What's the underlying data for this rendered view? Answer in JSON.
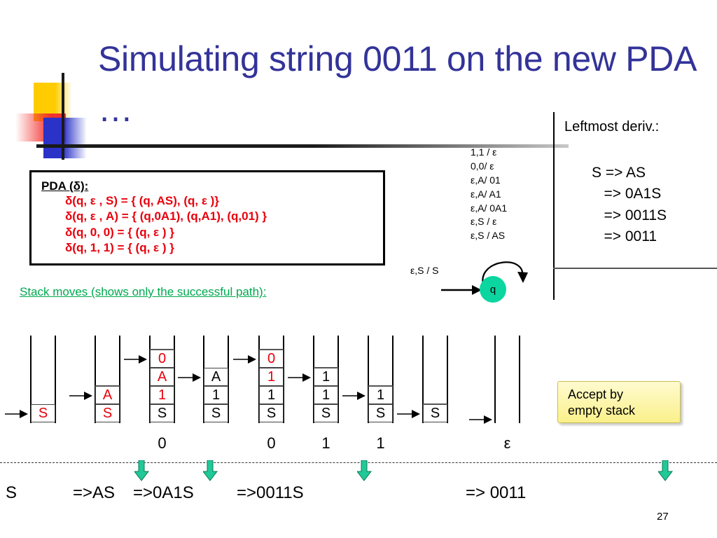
{
  "slide": {
    "title": "Simulating string 0011 on the new PDA …",
    "number": "27"
  },
  "pda_box": {
    "heading": "PDA (δ):",
    "rules": [
      "δ(q, ε , S) = { (q, AS), (q, ε )}",
      "δ(q, ε , A) = { (q,0A1), (q,A1), (q,01) }",
      "δ(q, 0, 0) = { (q, ε ) }",
      "δ(q, 1, 1) = { (q, ε ) }"
    ],
    "rule_color": "#E8000B"
  },
  "stack_moves": {
    "heading": "Stack moves (shows only the successful path):"
  },
  "automaton": {
    "state_label": "q",
    "state_color": "#0BD6A0",
    "start_label": "ε,S / S",
    "loop_labels": [
      "1,1 / ε",
      "0,0/ ε",
      "ε,A/ 01",
      "ε,A/ A1",
      "ε,A/ 0A1",
      "ε,S / ε",
      "ε,S / AS"
    ]
  },
  "leftmost": {
    "title": "Leftmost deriv.:",
    "lines": [
      "S => AS",
      "   => 0A1S",
      "   => 0011S",
      "   => 0011"
    ]
  },
  "accept_note": {
    "line1": "Accept by",
    "line2": "empty stack",
    "color": "#FAF08A"
  },
  "stacks": [
    {
      "cells": [
        {
          "t": "S",
          "red": true
        }
      ],
      "arrow_level": 0,
      "topline": false,
      "input": ""
    },
    {
      "cells": [
        {
          "t": "S",
          "red": true
        },
        {
          "t": "A",
          "red": true
        }
      ],
      "arrow_level": 1,
      "topline": true,
      "input": ""
    },
    {
      "cells": [
        {
          "t": "S",
          "red": false
        },
        {
          "t": "1",
          "red": true
        },
        {
          "t": "A",
          "red": true
        },
        {
          "t": "0",
          "red": true
        }
      ],
      "arrow_level": 3,
      "topline": true,
      "input": "0"
    },
    {
      "cells": [
        {
          "t": "S",
          "red": false
        },
        {
          "t": "1",
          "red": false
        },
        {
          "t": "A",
          "red": false
        }
      ],
      "arrow_level": 2,
      "topline": false,
      "input": ""
    },
    {
      "cells": [
        {
          "t": "S",
          "red": false
        },
        {
          "t": "1",
          "red": false
        },
        {
          "t": "1",
          "red": true
        },
        {
          "t": "0",
          "red": true
        }
      ],
      "arrow_level": 3,
      "topline": true,
      "input": "0"
    },
    {
      "cells": [
        {
          "t": "S",
          "red": false
        },
        {
          "t": "1",
          "red": false
        },
        {
          "t": "1",
          "red": false
        }
      ],
      "arrow_level": 2,
      "topline": true,
      "input": "1"
    },
    {
      "cells": [
        {
          "t": "S",
          "red": false
        },
        {
          "t": "1",
          "red": false
        }
      ],
      "arrow_level": 1,
      "topline": true,
      "input": "1"
    },
    {
      "cells": [
        {
          "t": "S",
          "red": false
        }
      ],
      "arrow_level": 0,
      "topline": true,
      "input": ""
    },
    {
      "cells": [],
      "arrow_level": -1,
      "topline": false,
      "input": "ε"
    }
  ],
  "bottom_derivation": {
    "steps": [
      "S",
      "=>AS",
      "=>0A1S",
      "=>0011S",
      "=> 0011"
    ]
  }
}
